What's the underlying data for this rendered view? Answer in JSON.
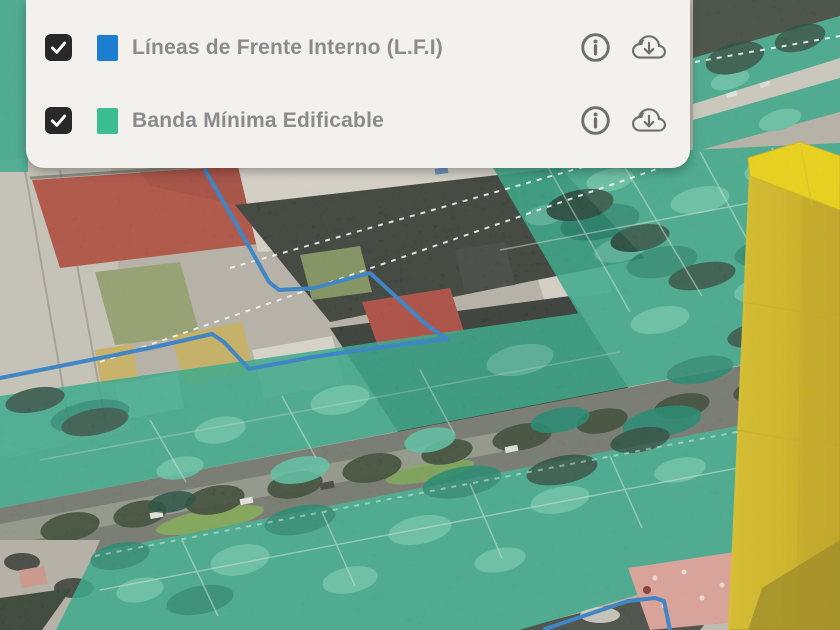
{
  "panel": {
    "layers": [
      {
        "label": "Líneas de Frente Interno (L.F.I)",
        "checked": true,
        "swatch_color": "#1b7ed1",
        "icons": {
          "info": "info-circle-icon",
          "download": "cloud-download-icon"
        }
      },
      {
        "label": "Banda Mínima Edificable",
        "checked": true,
        "swatch_color": "#3bbd92",
        "icons": {
          "info": "info-circle-icon",
          "download": "cloud-download-icon"
        }
      }
    ]
  },
  "map": {
    "overlay_colors": {
      "banda_minima_edificable": "#2aa987",
      "lineas_frente_interno": "#2b7ec9",
      "extruded_building": "#d3b71a"
    }
  }
}
